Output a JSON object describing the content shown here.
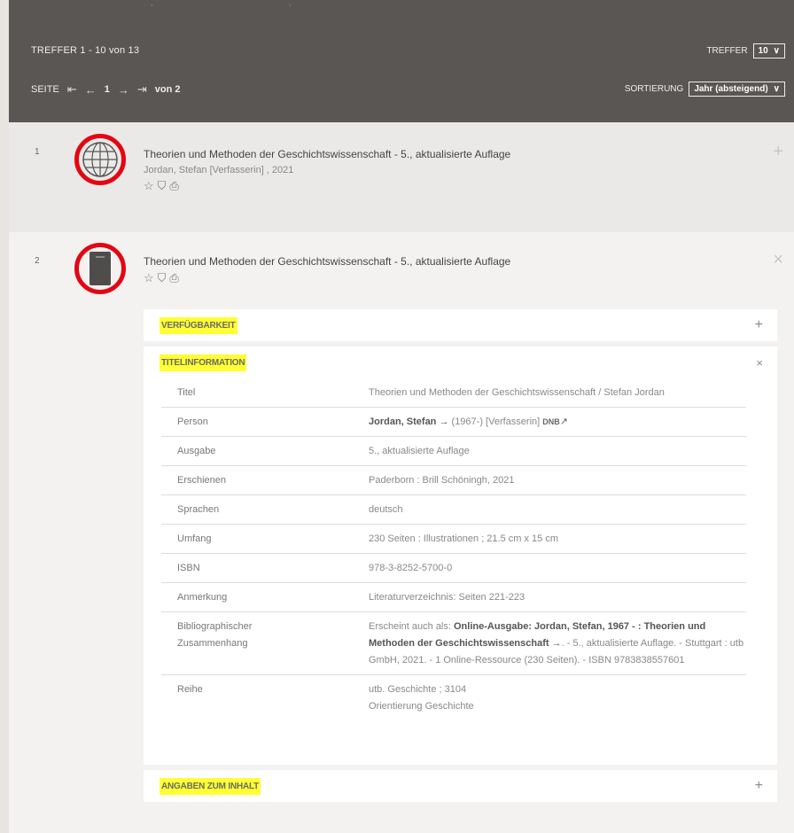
{
  "header": {
    "hits_range": "TREFFER 1 - 10 von 13",
    "page_label": "SEITE",
    "current_page": "1",
    "page_total": "von 2",
    "perpage_label": "TREFFER",
    "perpage_value": "10",
    "sort_label": "SORTIERUNG",
    "sort_value": "Jahr (absteigend)"
  },
  "results": [
    {
      "num": "1",
      "icon": "globe-icon",
      "title": "Theorien und Methoden der Geschichtswissenschaft - 5., aktualisierte Auflage",
      "author": "Jordan, Stefan [Verfasserin] , 2021",
      "corner": "+"
    },
    {
      "num": "2",
      "icon": "book-icon",
      "title": "Theorien und Methoden der Geschichtswissenschaft - 5., aktualisierte Auflage",
      "corner": "×",
      "sections": {
        "availability": "VERFÜGBARKEIT",
        "title_info": "TITELINFORMATION",
        "content": "ANGABEN ZUM INHALT"
      },
      "details": {
        "titel_k": "Titel",
        "titel_v": "Theorien und Methoden der Geschichtswissenschaft / Stefan Jordan",
        "person_k": "Person",
        "person_name": "Jordan, Stefan",
        "person_rest": "(1967-) [Verfasserin]",
        "person_link": "DNB",
        "ausgabe_k": "Ausgabe",
        "ausgabe_v": "5., aktualisierte Auflage",
        "erschienen_k": "Erschienen",
        "erschienen_v": "Paderborn : Brill Schöningh, 2021",
        "sprachen_k": "Sprachen",
        "sprachen_v": "deutsch",
        "umfang_k": "Umfang",
        "umfang_v": "230 Seiten : Illustrationen ; 21.5 cm x 15 cm",
        "isbn_k": "ISBN",
        "isbn_v": "978-3-8252-5700-0",
        "anmerkung_k": "Anmerkung",
        "anmerkung_v": "Literaturverzeichnis: Seiten 221-223",
        "biblio_k1": "Bibliographischer",
        "biblio_k2": "Zusammenhang",
        "biblio_v1": "Erscheint auch als:",
        "biblio_b1": "Online-Ausgabe: Jordan, Stefan, 1967 - :",
        "biblio_b2": "Theorien und Methoden der Geschichtswissenschaft",
        "biblio_v2": ". - 5., aktualisierte Auflage. - Stuttgart : utb GmbH, 2021. - 1 Online-Ressource (230 Seiten). - ISBN 9783838557601",
        "reihe_k": "Reihe",
        "reihe_v1": "utb. Geschichte ; 3104",
        "reihe_v2": "Orientierung Geschichte"
      }
    }
  ]
}
